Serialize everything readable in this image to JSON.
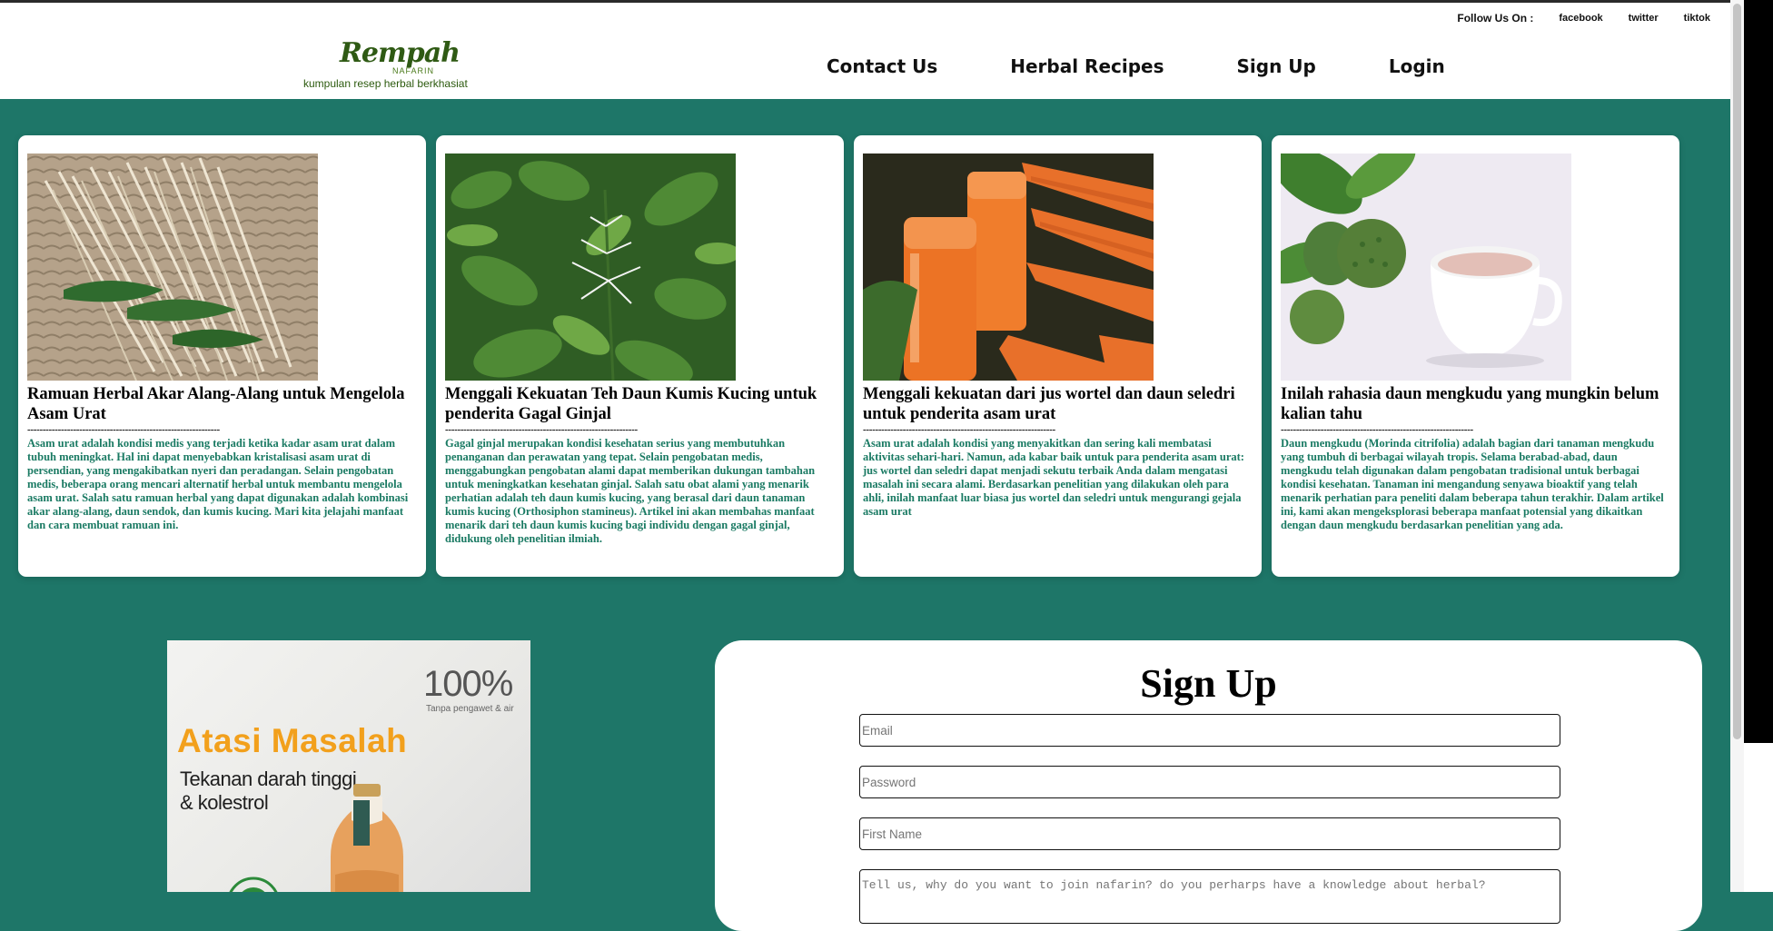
{
  "header": {
    "follow_label": "Follow Us On :",
    "socials": [
      "facebook",
      "twitter",
      "tiktok"
    ],
    "logo": {
      "script": "Rempah",
      "brand": "NAFARIN",
      "tagline": "kumpulan resep herbal berkhasiat"
    },
    "nav": [
      "Contact Us",
      "Herbal Recipes",
      "Sign Up",
      "Login"
    ]
  },
  "cards": [
    {
      "image": "akar-alang-alang",
      "title": "Ramuan Herbal Akar Alang-Alang untuk Mengelola Asam Urat",
      "divider": "---------------------------------------------------------------",
      "body": "Asam urat adalah kondisi medis yang terjadi ketika kadar asam urat dalam tubuh meningkat. Hal ini dapat menyebabkan kristalisasi asam urat di persendian, yang mengakibatkan nyeri dan peradangan. Selain pengobatan medis, beberapa orang mencari alternatif herbal untuk membantu mengelola asam urat. Salah satu ramuan herbal yang dapat digunakan adalah kombinasi akar alang-alang, daun sendok, dan kumis kucing. Mari kita jelajahi manfaat dan cara membuat ramuan ini."
    },
    {
      "image": "kumis-kucing",
      "title": "Menggali Kekuatan Teh Daun Kumis Kucing untuk penderita Gagal Ginjal",
      "divider": "---------------------------------------------------------------",
      "body": "Gagal ginjal merupakan kondisi kesehatan serius yang membutuhkan penanganan dan perawatan yang tepat. Selain pengobatan medis, menggabungkan pengobatan alami dapat memberikan dukungan tambahan untuk meningkatkan kesehatan ginjal. Salah satu obat alami yang menarik perhatian adalah teh daun kumis kucing, yang berasal dari daun tanaman kumis kucing (Orthosiphon stamineus). Artikel ini akan membahas manfaat menarik dari teh daun kumis kucing bagi individu dengan gagal ginjal, didukung oleh penelitian ilmiah."
    },
    {
      "image": "jus-wortel",
      "title": "Menggali kekuatan dari jus wortel dan daun seledri untuk penderita asam urat",
      "divider": "---------------------------------------------------------------",
      "body": "Asam urat adalah kondisi yang menyakitkan dan sering kali membatasi aktivitas sehari-hari. Namun, ada kabar baik untuk para penderita asam urat: jus wortel dan seledri dapat menjadi sekutu terbaik Anda dalam mengatasi masalah ini secara alami. Berdasarkan penelitian yang dilakukan oleh para ahli, inilah manfaat luar biasa jus wortel dan seledri untuk mengurangi gejala asam urat"
    },
    {
      "image": "daun-mengkudu",
      "title": "Inilah rahasia daun mengkudu yang mungkin belum kalian tahu",
      "divider": "---------------------------------------------------------------",
      "body": "Daun mengkudu (Morinda citrifolia) adalah bagian dari tanaman mengkudu yang tumbuh di berbagai wilayah tropis. Selama berabad-abad, daun mengkudu telah digunakan dalam pengobatan tradisional untuk berbagai kondisi kesehatan. Tanaman ini mengandung senyawa bioaktif yang telah menarik perhatian para peneliti dalam beberapa tahun terakhir. Dalam artikel ini, kami akan mengeksplorasi beberapa manfaat potensial yang dikaitkan dengan daun mengkudu berdasarkan penelitian yang ada."
    }
  ],
  "ad": {
    "percent": "100%",
    "percent_sub": "Tanpa pengawet & air",
    "headline": "Atasi Masalah",
    "line1": "Tekanan darah tinggi",
    "line2": "& kolestrol"
  },
  "signup": {
    "title": "Sign Up",
    "email_placeholder": "Email",
    "password_placeholder": "Password",
    "firstname_placeholder": "First Name",
    "reason_placeholder": "Tell us, why do you want to join nafarin? do you perharps have a knowledge about herbal?"
  },
  "colors": {
    "background": "#1e7668",
    "card_text": "#1a7a63",
    "ad_headline": "#f2a01c"
  }
}
